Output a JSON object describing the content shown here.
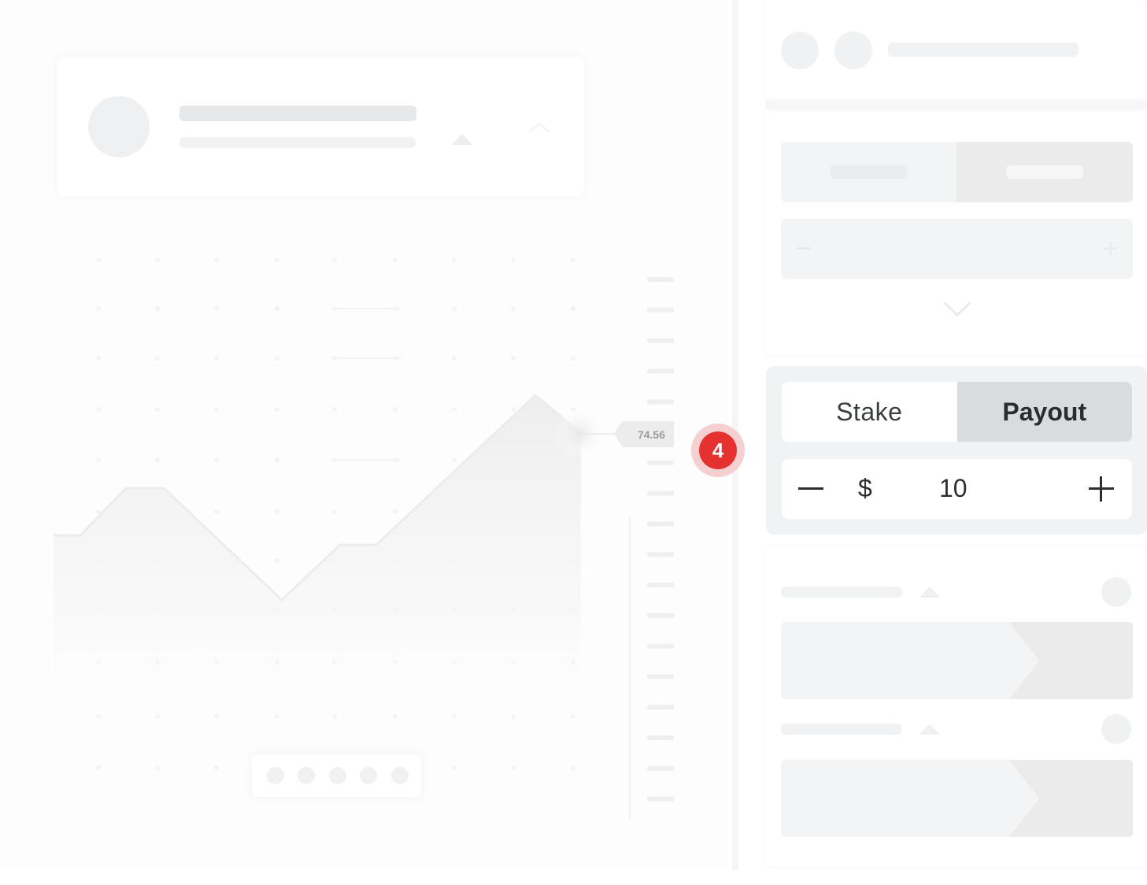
{
  "chart": {
    "price_label": "74.56"
  },
  "step_badge": {
    "number": "4"
  },
  "amount_panel": {
    "stake_label": "Stake",
    "payout_label": "Payout",
    "selected": "Payout",
    "currency_symbol": "$",
    "amount_value": "10",
    "minus_icon": "minus-icon",
    "plus_icon": "plus-icon"
  },
  "colors": {
    "badge_red": "#e5312f",
    "badge_halo": "#f6cfd1",
    "selected_tab_bg": "#d9dbdc",
    "skeleton": "#ebeced"
  }
}
